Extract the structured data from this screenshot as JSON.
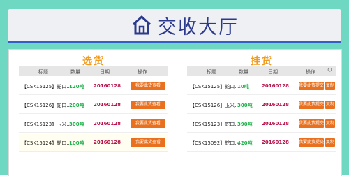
{
  "header": {
    "title": "交收大厅",
    "icon": "house-icon"
  },
  "left_panel": {
    "title": "选货",
    "columns": [
      "标题",
      "数量",
      "日期",
      "操作"
    ],
    "rows": [
      {
        "title": "【CSK15125】蛇口...",
        "qty": "120吨",
        "date": "20160128",
        "action": "我要此货查看"
      },
      {
        "title": "【CSK15126】蛇口...",
        "qty": "200吨",
        "date": "20160128",
        "action": "我要此货查看"
      },
      {
        "title": "【CSK15123】玉米...",
        "qty": "300吨",
        "date": "20160128",
        "action": "我要此货查看"
      },
      {
        "title": "【CSK15124】蛇口...",
        "qty": "100吨",
        "date": "20160128",
        "action": "我要此货查看"
      }
    ]
  },
  "right_panel": {
    "title": "挂货",
    "columns": [
      "标题",
      "数量",
      "日期",
      "操作"
    ],
    "rows": [
      {
        "title": "【CSK15125】蛇口...",
        "qty": "10吨",
        "date": "20160128",
        "action": "我要此货提交",
        "action2": "复制"
      },
      {
        "title": "【CSK15126】玉米...",
        "qty": "300吨",
        "date": "20160128",
        "action": "我要此货提交",
        "action2": "复制"
      },
      {
        "title": "【CSK15123】蛇口...",
        "qty": "390吨",
        "date": "20160128",
        "action": "我要此货提交",
        "action2": "复制"
      },
      {
        "title": "【CSK15092】蛇口...",
        "qty": "420吨",
        "date": "20160128",
        "action": "我要此货提交",
        "action2": "复制"
      }
    ]
  },
  "colors": {
    "accent": "#f29a1c",
    "button": "#e8701e",
    "qty": "#22b14c",
    "date": "#b8144a",
    "title": "#2b3a8c"
  }
}
